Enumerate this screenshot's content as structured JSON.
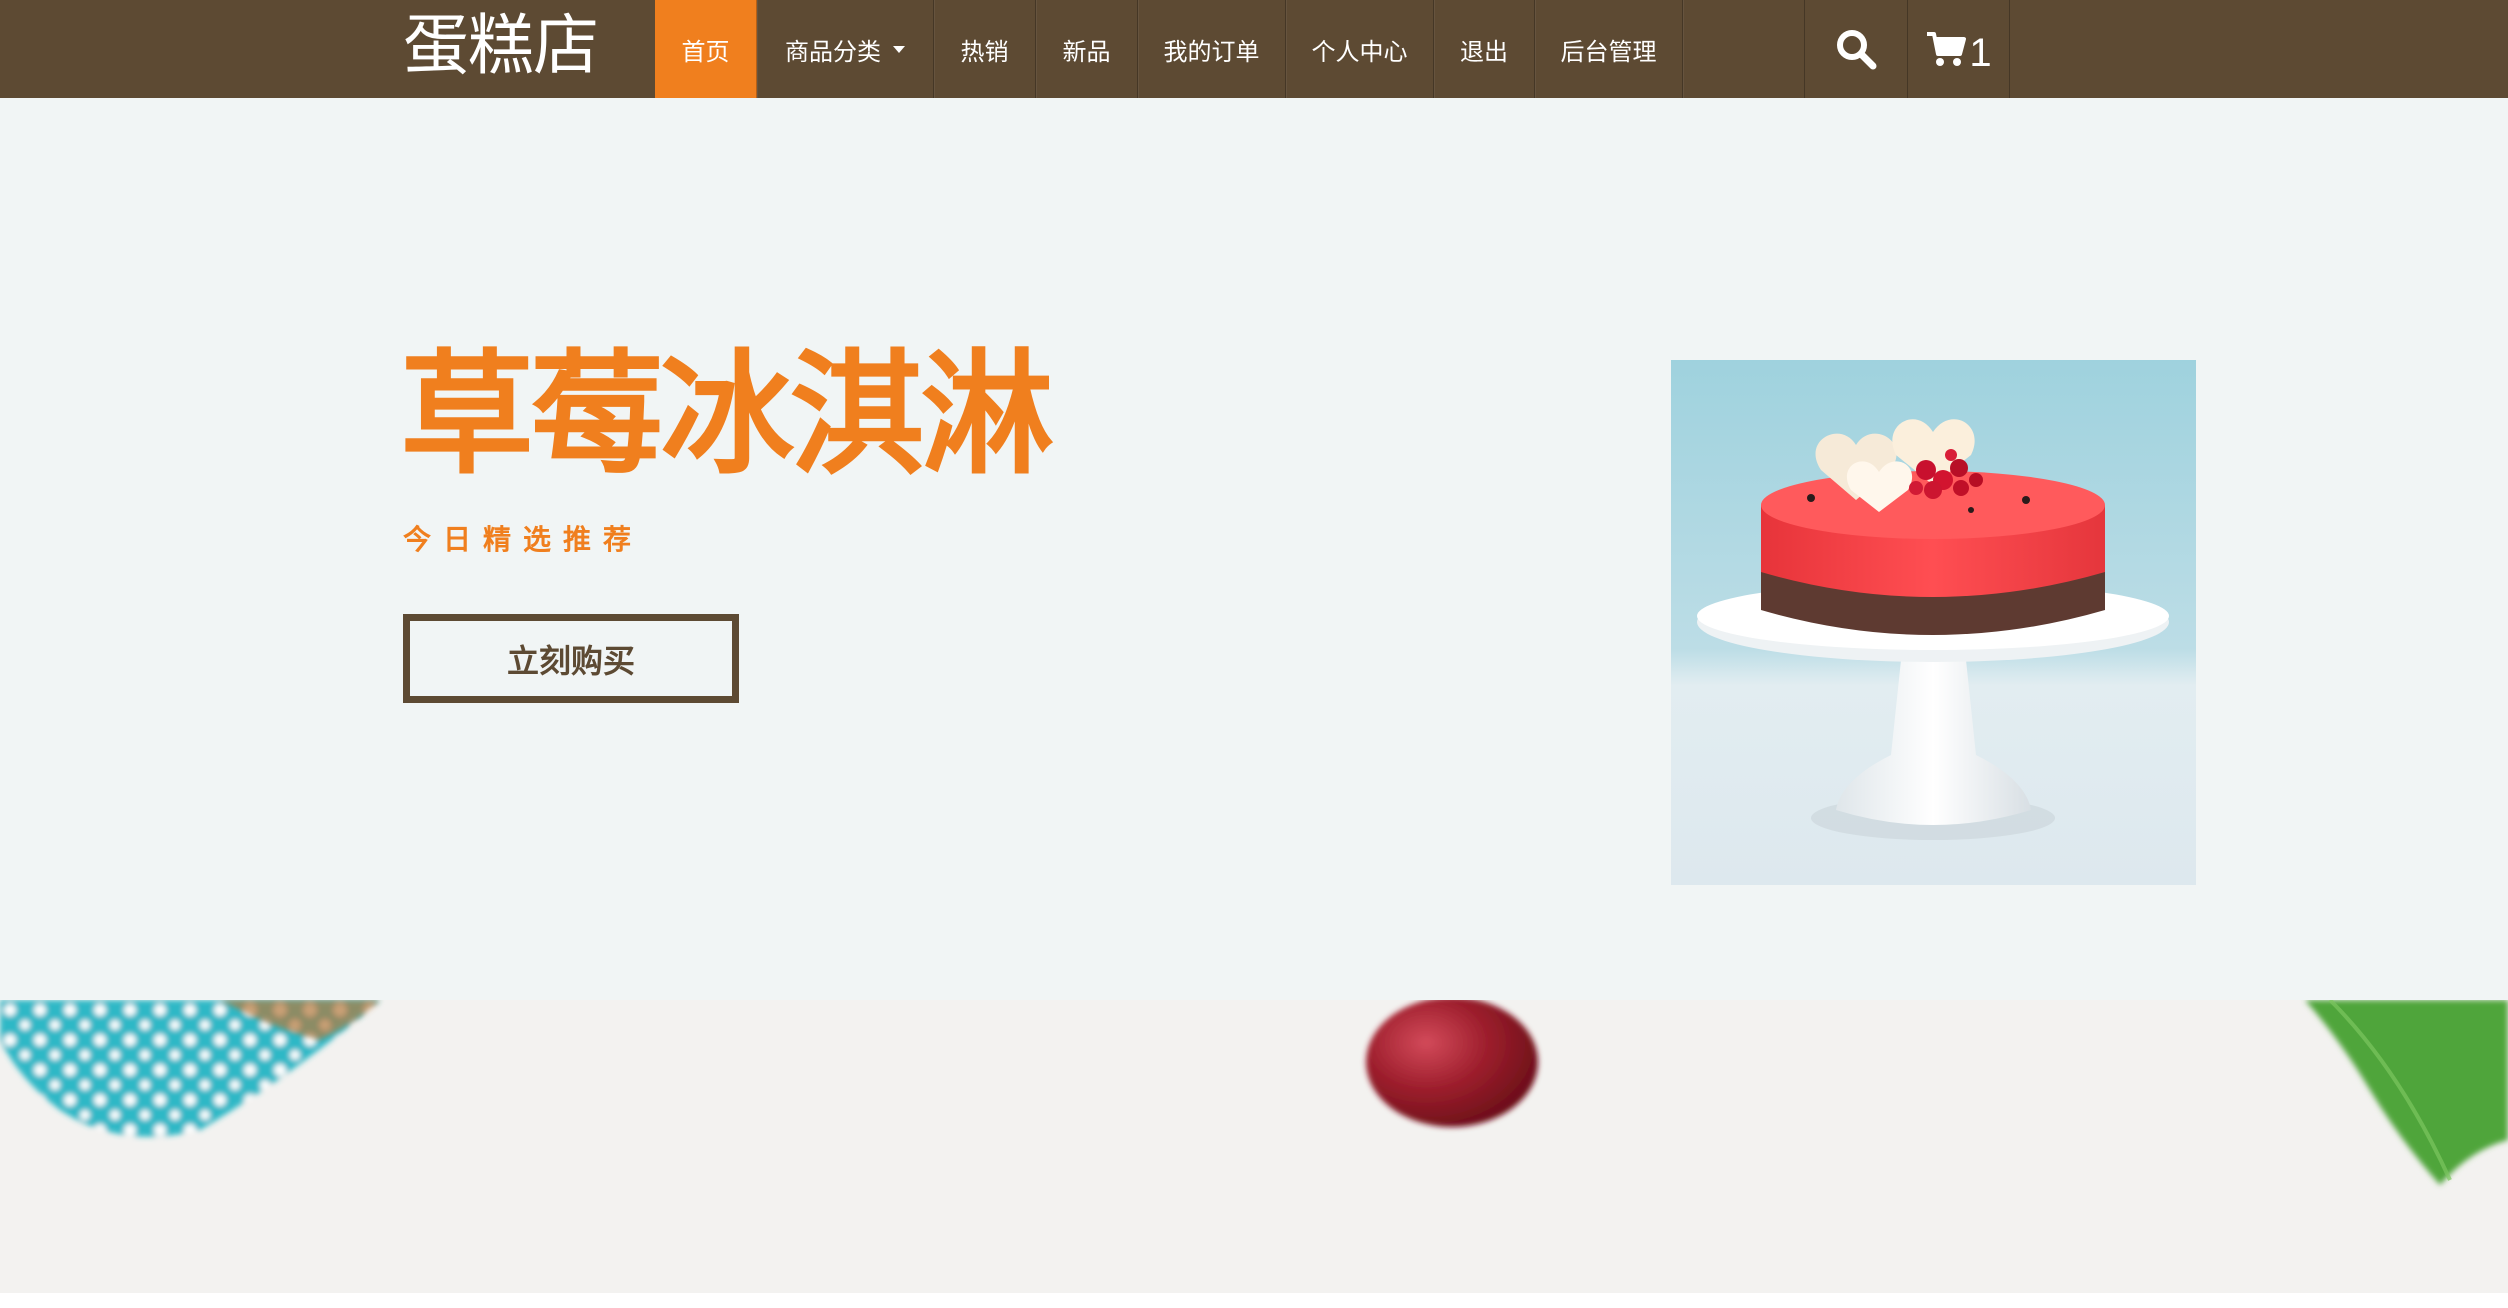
{
  "brand": "蛋糕店",
  "nav": {
    "items": [
      {
        "label": "首页"
      },
      {
        "label": "商品分类"
      },
      {
        "label": "热销"
      },
      {
        "label": "新品"
      },
      {
        "label": "我的订单"
      },
      {
        "label": "个人中心"
      },
      {
        "label": "退出"
      },
      {
        "label": "后台管理"
      }
    ],
    "active_index": 0,
    "cart_count": "1"
  },
  "hero": {
    "title": "草莓冰淇淋",
    "subtitle": "今日精选推荐",
    "button_label": "立刻购买"
  },
  "icons": {
    "search": "search-icon",
    "cart": "shopping-cart-icon",
    "dropdown": "caret-down-icon"
  },
  "colors": {
    "navbar": "#5d4a33",
    "accent": "#f07f1e",
    "hero_bg": "#f1f5f5",
    "decor_bg": "#f3f2f0"
  }
}
